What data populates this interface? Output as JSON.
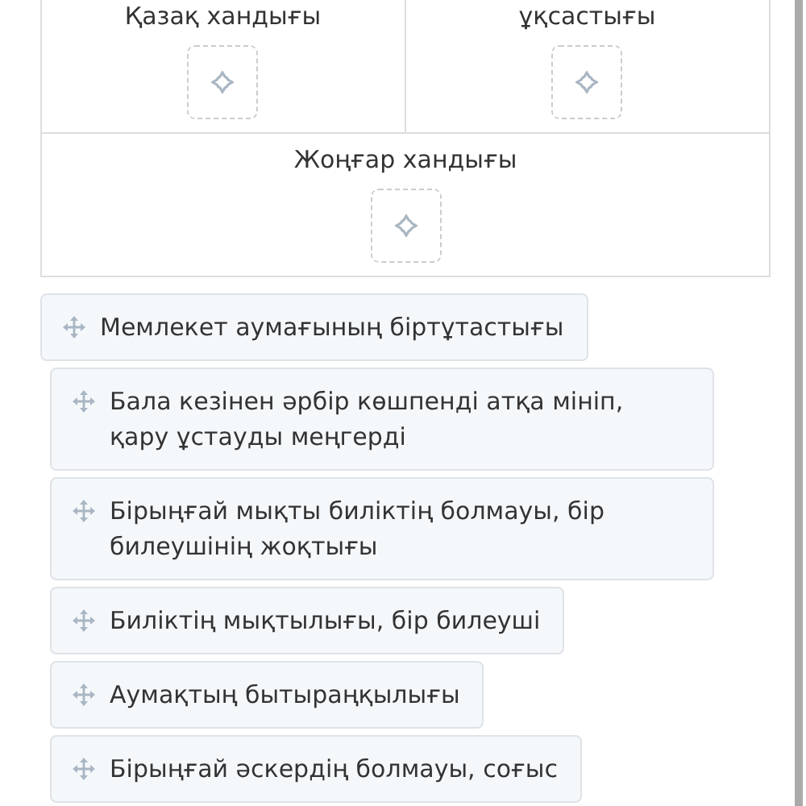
{
  "drop_grid": {
    "cells": [
      {
        "label": "Қазақ хандығы"
      },
      {
        "label": "ұқсастығы"
      },
      {
        "label": "Жоңғар хандығы"
      }
    ]
  },
  "options": [
    {
      "label": "Мемлекет аумағының біртұтастығы"
    },
    {
      "label": "Бала кезінен әрбір көшпенді атқа мініп, қару ұстауды меңгерді"
    },
    {
      "label": "Бірыңғай мықты биліктің болмауы, бір билеушінің жоқтығы"
    },
    {
      "label": "Биліктің мықтылығы, бір билеуші"
    },
    {
      "label": "Аумақтың бытыраңқылығы"
    },
    {
      "label": "Бірыңғай әскердің болмауы, соғыс"
    }
  ]
}
